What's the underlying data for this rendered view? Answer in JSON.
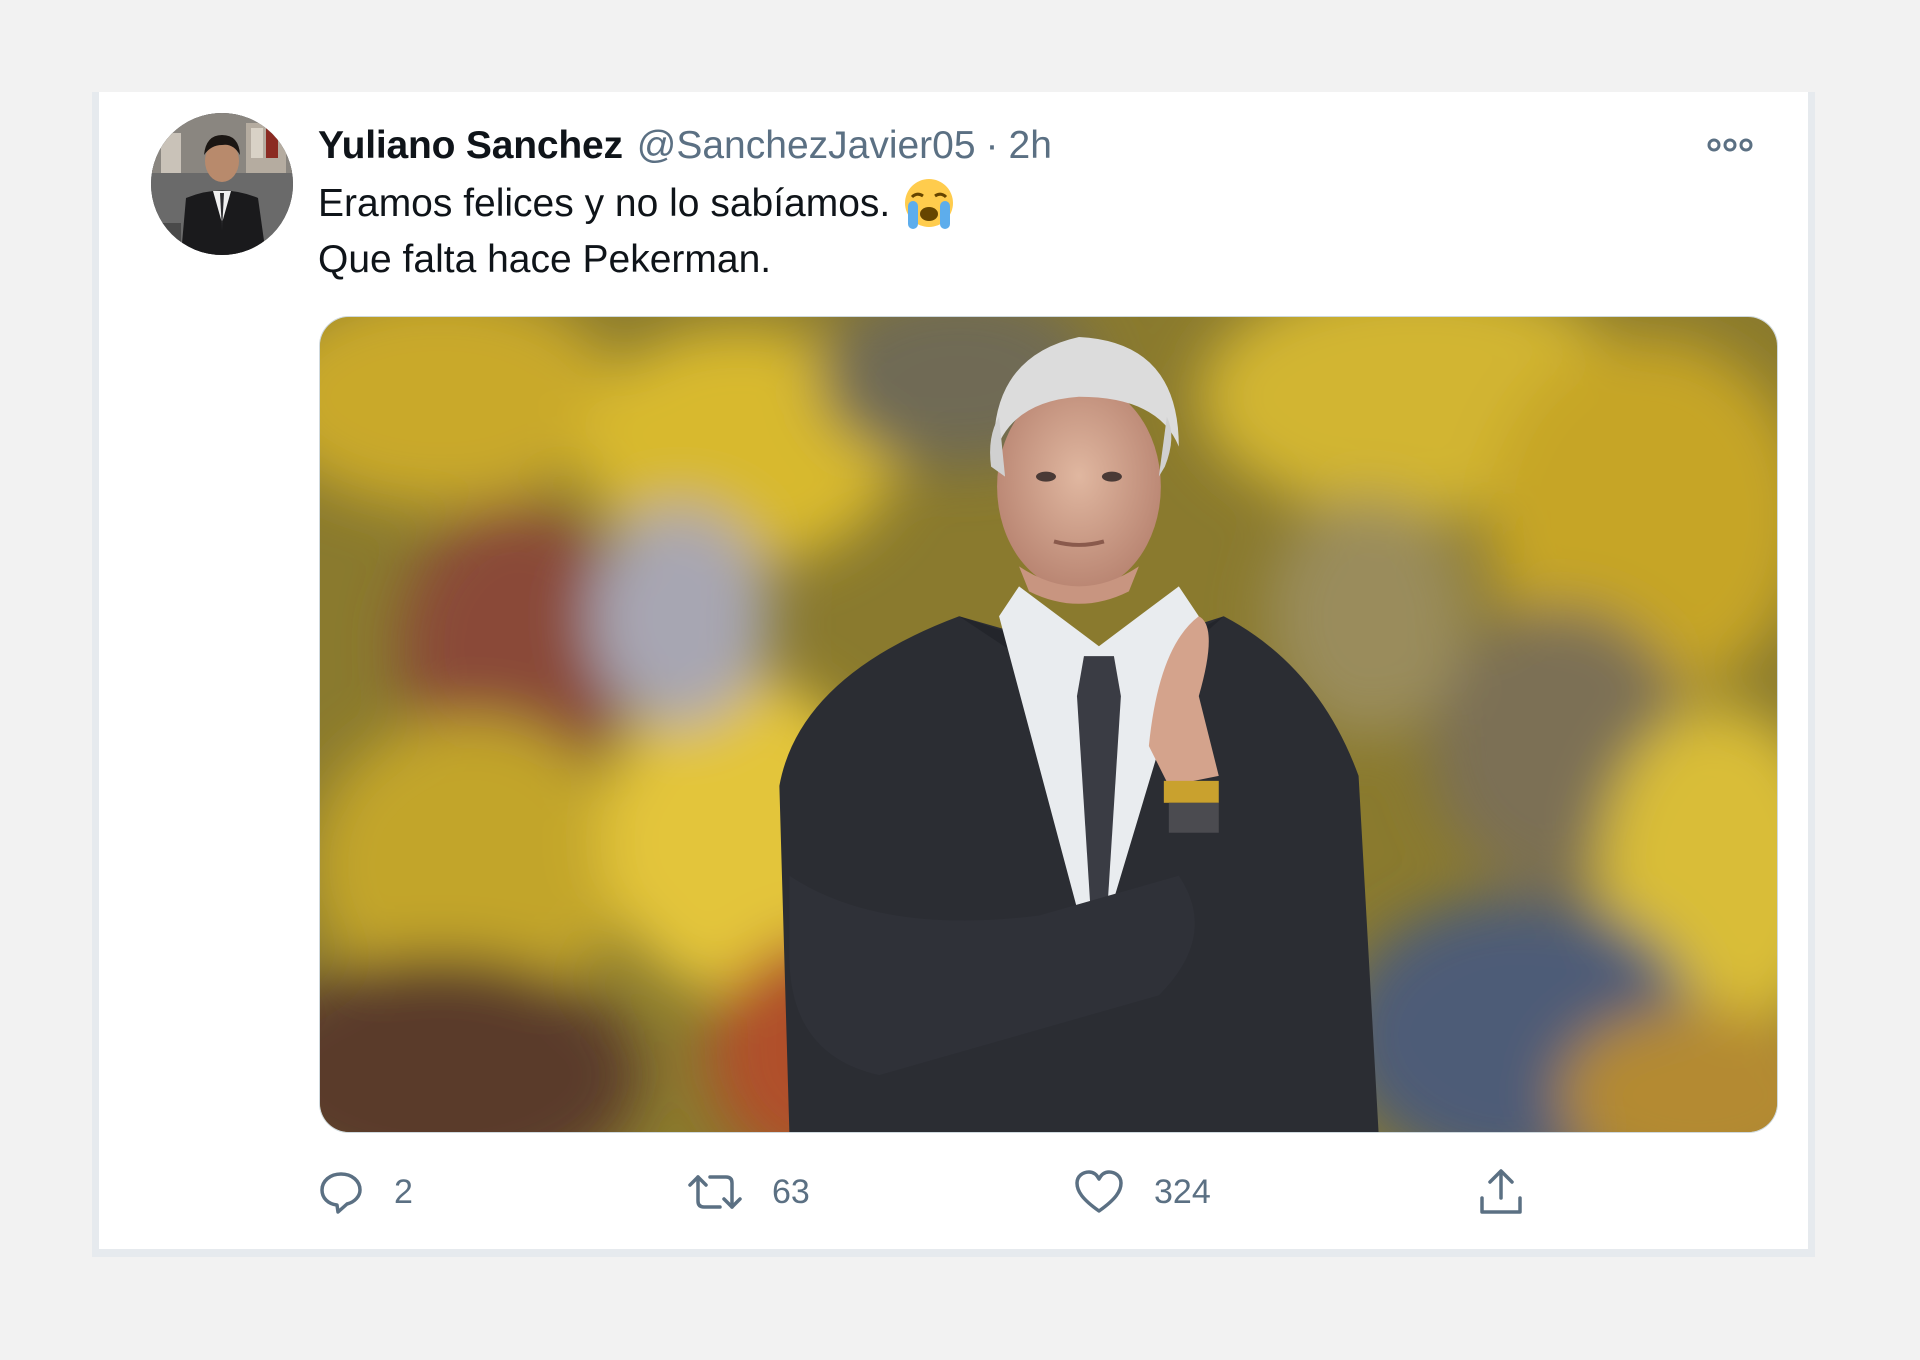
{
  "tweet": {
    "display_name": "Yuliano Sanchez",
    "handle": "@SanchezJavier05",
    "separator": "·",
    "time": "2h",
    "text_line_1": "Eramos felices y no lo sabíamos.",
    "text_line_1_emoji": "loudly-crying-face-emoji",
    "text_line_2": "Que falta hace Pekerman."
  },
  "actions": {
    "reply_count": "2",
    "retweet_count": "63",
    "like_count": "324"
  },
  "icons": {
    "more": "more-options-icon",
    "reply": "reply-icon",
    "retweet": "retweet-icon",
    "like": "heart-icon",
    "share": "share-icon"
  },
  "colors": {
    "text_primary": "#0f1419",
    "text_secondary": "#5b7083",
    "background": "#f2f2f2",
    "card": "#ffffff"
  }
}
